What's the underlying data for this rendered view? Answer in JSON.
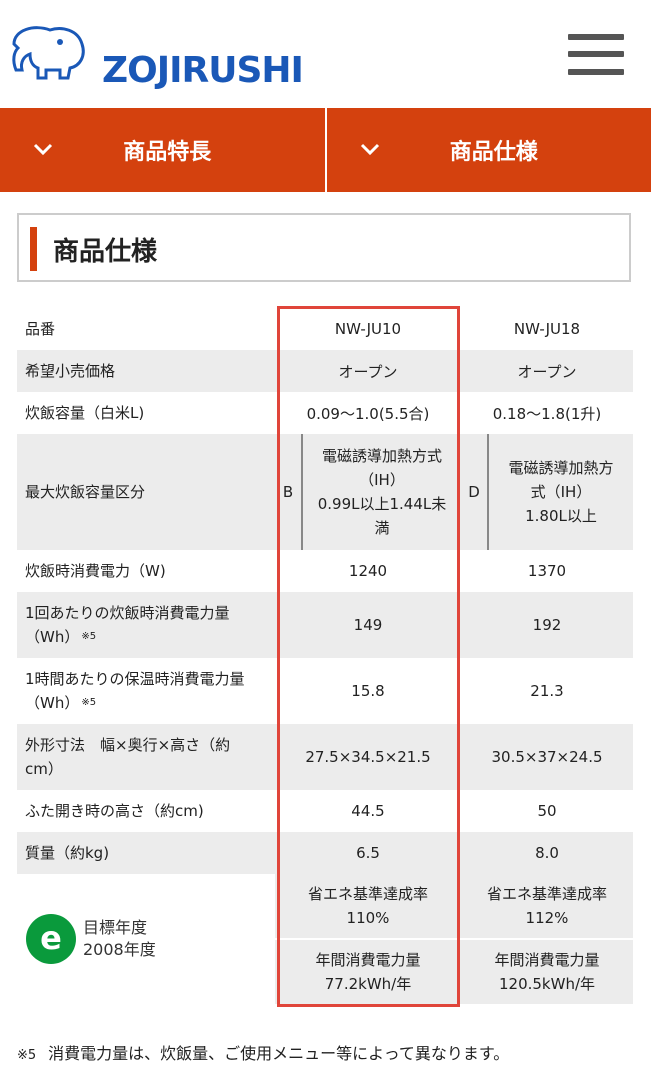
{
  "header": {
    "logo_text": "ZOJIRUSHI",
    "menu_icon": "hamburger-icon"
  },
  "nav": {
    "features_label": "商品特長",
    "specs_label": "商品仕様",
    "chevron_icon": "chevron-down-icon",
    "bg_color": "#d4410e"
  },
  "section": {
    "title": "商品仕様"
  },
  "spec_table": {
    "rows": [
      {
        "label": "品番",
        "v1": "NW-JU10",
        "v2": "NW-JU18"
      },
      {
        "label": "希望小売価格",
        "v1": "オープン",
        "v2": "オープン"
      },
      {
        "label": "炊飯容量（白米L)",
        "v1": "0.09〜1.0(5.5合)",
        "v2": "0.18〜1.8(1升)"
      },
      {
        "label": "最大炊飯容量区分",
        "v1_letter": "B",
        "v1_desc": [
          "電磁誘導加熱方式",
          "（IH）",
          "0.99L以上1.44L未",
          "満"
        ],
        "v2_letter": "D",
        "v2_desc": [
          "電磁誘導加熱方",
          "式（IH）",
          "1.80L以上"
        ]
      },
      {
        "label": "炊飯時消費電力（W)",
        "v1": "1240",
        "v2": "1370"
      },
      {
        "label_lines": [
          "1回あたりの炊飯時消費電力量",
          "（Wh）"
        ],
        "note": "※5",
        "v1": "149",
        "v2": "192"
      },
      {
        "label_lines": [
          "1時間あたりの保温時消費電力量",
          "（Wh）"
        ],
        "note": "※5",
        "v1": "15.8",
        "v2": "21.3"
      },
      {
        "label_lines": [
          "外形寸法　幅×奥行×高さ（約",
          "cm）"
        ],
        "v1": "27.5×34.5×21.5",
        "v2": "30.5×37×24.5"
      },
      {
        "label": "ふた開き時の高さ（約cm)",
        "v1": "44.5",
        "v2": "50"
      },
      {
        "label": "質量（約kg)",
        "v1": "6.5",
        "v2": "8.0"
      }
    ],
    "energy": {
      "logo_letter": "e",
      "logo_line1": "目標年度",
      "logo_line2": "2008年度",
      "v1_rate_label": "省エネ基準達成率",
      "v1_rate": "110%",
      "v1_annual_label": "年間消費電力量",
      "v1_annual": "77.2kWh/年",
      "v2_rate_label": "省エネ基準達成率",
      "v2_rate": "112%",
      "v2_annual_label": "年間消費電力量",
      "v2_annual": "120.5kWh/年"
    }
  },
  "footnote": {
    "mark": "※5",
    "text": "消費電力量は、炊飯量、ご使用メニュー等によって異なります。"
  }
}
